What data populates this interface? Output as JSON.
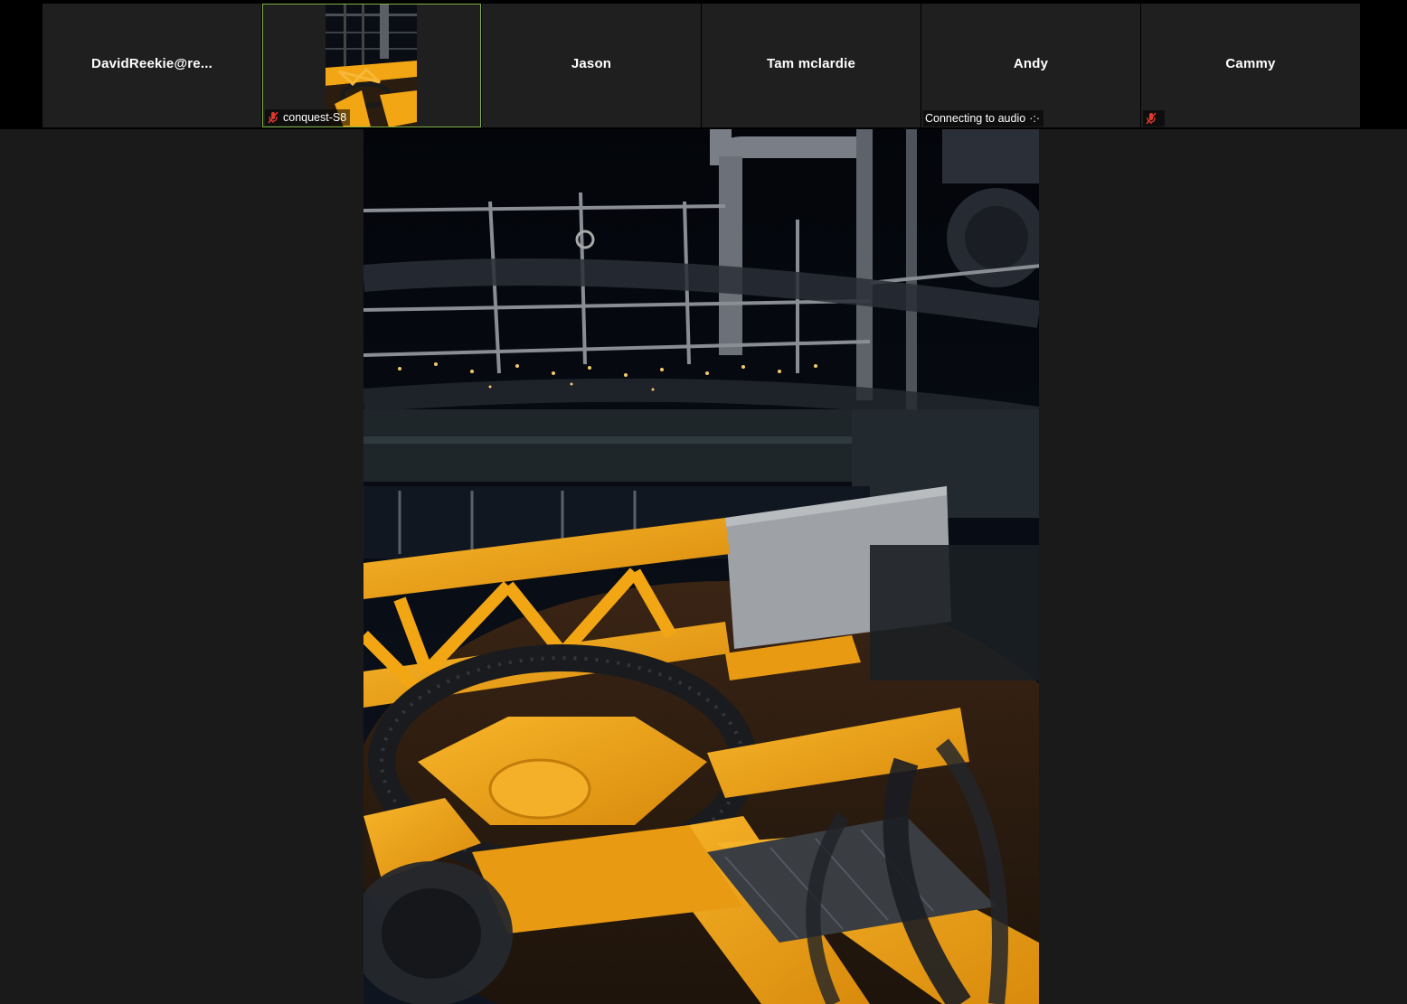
{
  "participants": [
    {
      "name": "DavidReekie@re...",
      "label": "",
      "muted": false,
      "video": false,
      "active": false
    },
    {
      "name": "",
      "label": "conquest-S8",
      "muted": true,
      "video": true,
      "active": true
    },
    {
      "name": "Jason",
      "label": "",
      "muted": false,
      "video": false,
      "active": false
    },
    {
      "name": "Tam mclardie",
      "label": "",
      "muted": false,
      "video": false,
      "active": false
    },
    {
      "name": "Andy",
      "label": "Connecting to audio",
      "label_suffix": "·:·",
      "muted": false,
      "video": false,
      "active": false
    },
    {
      "name": "Cammy",
      "label": "",
      "muted": true,
      "video": false,
      "active": false
    }
  ],
  "colors": {
    "background": "#1a1a1a",
    "tile_background": "#1f1f1f",
    "active_border": "#7fb046",
    "mute_red": "#e0382e",
    "machinery_yellow": "#f2a614"
  },
  "main_video": {
    "content": "video-feed"
  }
}
